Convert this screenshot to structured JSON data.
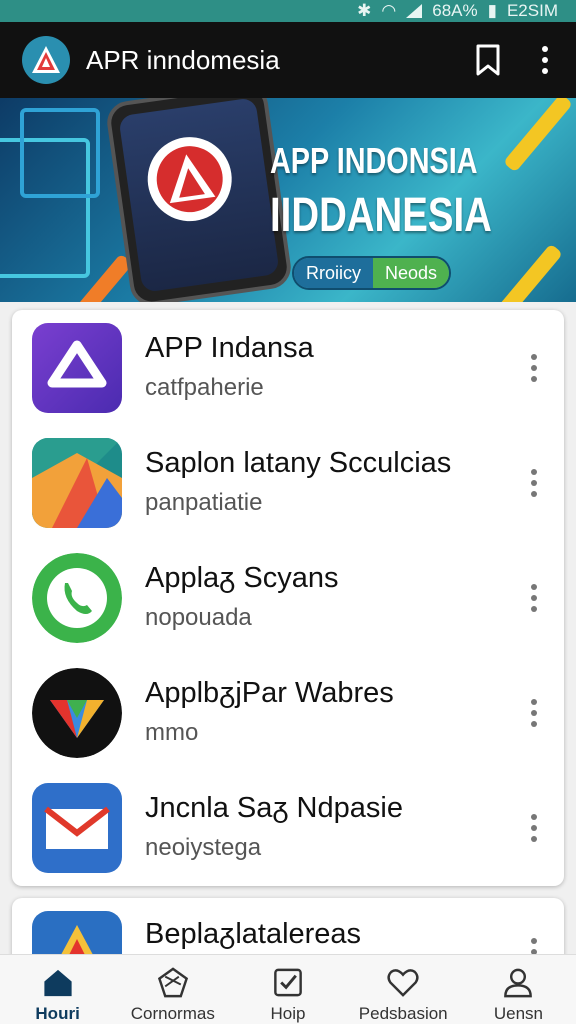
{
  "status_bar": {
    "battery": "68A%",
    "time": "E2SIM"
  },
  "app_bar": {
    "title": "APR inndomesia"
  },
  "banner": {
    "headline_1": "APP INDONSIA",
    "headline_2": "IIDDANESIA",
    "pill_left": "Rroiicy",
    "pill_right": "Neods"
  },
  "apps": [
    {
      "title": "APP Indansa",
      "subtitle": "catfpaherie",
      "icon": "triangle-logo-icon"
    },
    {
      "title": "Saplon latany Scculcias",
      "subtitle": "panpatiatie",
      "icon": "maps-icon"
    },
    {
      "title": "Applaᵹ Scyans",
      "subtitle": "nopouada",
      "icon": "phone-icon"
    },
    {
      "title": "ApplbᵹjPar Wabres",
      "subtitle": "mmo",
      "icon": "w-logo-icon"
    },
    {
      "title": "Jncnla Saᵹ Ndpasie",
      "subtitle": "neoiystega",
      "icon": "mail-icon"
    },
    {
      "title": "Beplaᵹlatalereas",
      "subtitle": "",
      "icon": "app-logo-icon"
    }
  ],
  "bottom_nav": [
    {
      "label": "Houri",
      "icon": "home-icon",
      "active": true
    },
    {
      "label": "Cornormas",
      "icon": "community-icon",
      "active": false
    },
    {
      "label": "Hoip",
      "icon": "checkbox-icon",
      "active": false
    },
    {
      "label": "Pedsbasion",
      "icon": "heart-icon",
      "active": false
    },
    {
      "label": "Uensn",
      "icon": "user-icon",
      "active": false
    }
  ],
  "colors": {
    "status_bar": "#2e8f86",
    "app_bar": "#111111",
    "accent": "#0e3b5e",
    "pill_green": "#4fb14f"
  }
}
